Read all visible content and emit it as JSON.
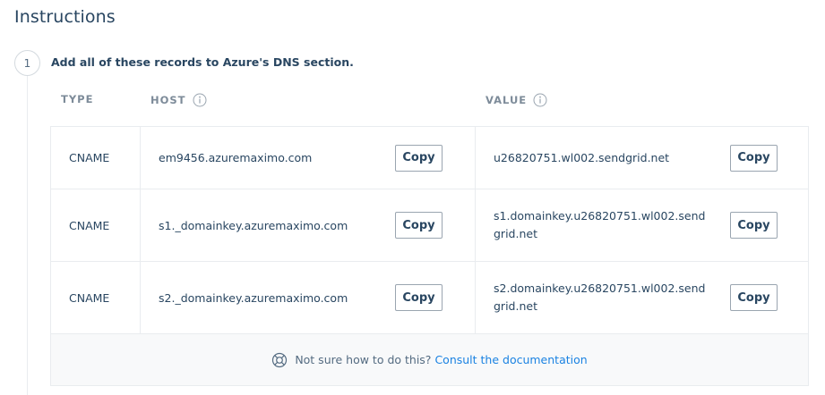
{
  "page": {
    "title": "Instructions"
  },
  "step": {
    "number": "1",
    "text": "Add all of these records to Azure's DNS section."
  },
  "table": {
    "headers": {
      "type": "TYPE",
      "host": "HOST",
      "value": "VALUE"
    },
    "copy_label": "Copy",
    "rows": [
      {
        "type": "CNAME",
        "host": "em9456.azuremaximo.com",
        "value": "u26820751.wl002.sendgrid.net"
      },
      {
        "type": "CNAME",
        "host": "s1._domainkey.azuremaximo.com",
        "value": "s1.domainkey.u26820751.wl002.sendgrid.net"
      },
      {
        "type": "CNAME",
        "host": "s2._domainkey.azuremaximo.com",
        "value": "s2.domainkey.u26820751.wl002.sendgrid.net"
      }
    ]
  },
  "footer": {
    "icon": "lifebuoy-icon",
    "text": "Not sure how to do this?",
    "link": "Consult the documentation"
  },
  "colors": {
    "text": "#294661",
    "muted": "#7d8b99",
    "link": "#1a82e2",
    "border": "#e9ecef"
  }
}
